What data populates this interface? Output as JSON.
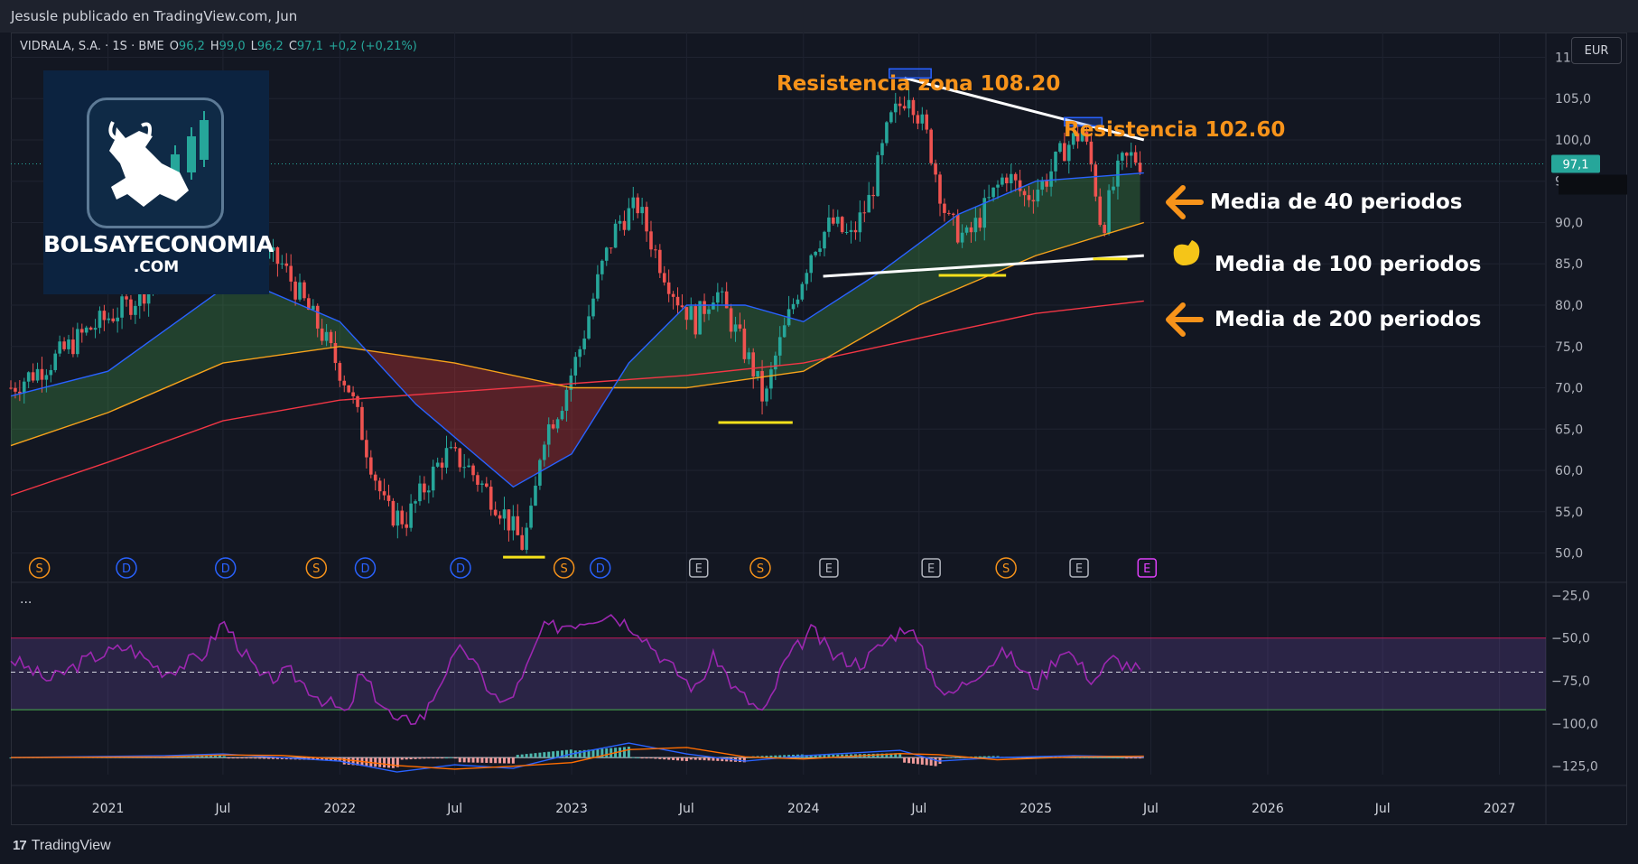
{
  "header": {
    "publisher_text": "Jesusle publicado en TradingView.com, Jun"
  },
  "legend": {
    "symbol": "VIDRALA, S.A. · 1S · BME",
    "open_label": "O",
    "open": "96,2",
    "high_label": "H",
    "high": "99,0",
    "low_label": "L",
    "low": "96,2",
    "close_label": "C",
    "close": "97,1",
    "change": "+0,2 (+0,21%)"
  },
  "currency": "EUR",
  "logo": {
    "name": "BOLSAYECONOMIA",
    "sub": ".COM"
  },
  "pane_menu": "···",
  "annotations": {
    "res1": "Resistencia zona 108.20",
    "res2": "Resistencia 102.60",
    "ma40": "Media de 40 periodos",
    "ma100": "Media de 100 periodos",
    "ma200": "Media de 200 periodos"
  },
  "footer": {
    "brand": "TradingView",
    "mark": "17"
  },
  "colors": {
    "bull": "#26a69a",
    "bear": "#ef5350",
    "ma40": "#2962ff",
    "ma100": "#f7a21b",
    "ma200": "#f23645",
    "rsi": "#9c27b0",
    "accent_orange": "#f7931a",
    "support_yellow": "#f5e11b",
    "trend_white": "#ffffff"
  },
  "chart_data": {
    "type": "candlestick",
    "symbol": "VIDRALA, S.A.",
    "timeframe": "1S",
    "price_axis": {
      "ylim": [
        47,
        113
      ],
      "ticks": [
        "110,0",
        "105,0",
        "100,0",
        "95,0",
        "90,0",
        "85,0",
        "80,0",
        "75,0",
        "70,0",
        "65,0",
        "60,0",
        "55,0",
        "50,0"
      ],
      "last_price": "97,1",
      "last_value": 97.1
    },
    "x_axis": {
      "range": [
        "2020-08-01",
        "2027-03-15"
      ],
      "ticks": [
        {
          "label": "2021",
          "date": "2021-01-01"
        },
        {
          "label": "Jul",
          "date": "2021-07-01"
        },
        {
          "label": "2022",
          "date": "2022-01-01"
        },
        {
          "label": "Jul",
          "date": "2022-07-01"
        },
        {
          "label": "2023",
          "date": "2023-01-01"
        },
        {
          "label": "Jul",
          "date": "2023-07-01"
        },
        {
          "label": "2024",
          "date": "2024-01-01"
        },
        {
          "label": "Jul",
          "date": "2024-07-01"
        },
        {
          "label": "2025",
          "date": "2025-01-01"
        },
        {
          "label": "Jul",
          "date": "2025-07-01"
        },
        {
          "label": "2026",
          "date": "2026-01-01"
        },
        {
          "label": "Jul",
          "date": "2026-07-01"
        },
        {
          "label": "2027",
          "date": "2027-01-01"
        }
      ]
    },
    "price_path": [
      [
        "2020-08-01",
        70
      ],
      [
        "2020-10-01",
        73
      ],
      [
        "2020-12-01",
        77
      ],
      [
        "2021-02-01",
        80
      ],
      [
        "2021-04-01",
        84
      ],
      [
        "2021-06-01",
        88
      ],
      [
        "2021-08-01",
        87
      ],
      [
        "2021-10-01",
        85
      ],
      [
        "2021-12-01",
        77
      ],
      [
        "2022-01-15",
        70
      ],
      [
        "2022-02-15",
        62
      ],
      [
        "2022-03-15",
        55
      ],
      [
        "2022-04-15",
        54
      ],
      [
        "2022-05-15",
        58
      ],
      [
        "2022-06-15",
        62
      ],
      [
        "2022-07-15",
        61
      ],
      [
        "2022-08-15",
        58
      ],
      [
        "2022-09-15",
        55
      ],
      [
        "2022-10-15",
        51
      ],
      [
        "2022-11-01",
        55
      ],
      [
        "2022-11-15",
        64
      ],
      [
        "2022-12-15",
        68
      ],
      [
        "2023-01-15",
        75
      ],
      [
        "2023-02-15",
        84
      ],
      [
        "2023-03-15",
        90
      ],
      [
        "2023-04-15",
        92
      ],
      [
        "2023-05-15",
        86
      ],
      [
        "2023-06-15",
        81
      ],
      [
        "2023-07-15",
        78
      ],
      [
        "2023-08-15",
        82
      ],
      [
        "2023-09-15",
        77
      ],
      [
        "2023-10-15",
        72
      ],
      [
        "2023-11-01",
        68
      ],
      [
        "2023-11-15",
        73
      ],
      [
        "2023-12-15",
        80
      ],
      [
        "2024-01-15",
        87
      ],
      [
        "2024-02-15",
        90
      ],
      [
        "2024-03-15",
        88
      ],
      [
        "2024-04-15",
        93
      ],
      [
        "2024-05-15",
        102
      ],
      [
        "2024-06-15",
        106
      ],
      [
        "2024-07-15",
        100
      ],
      [
        "2024-08-15",
        90
      ],
      [
        "2024-09-15",
        88
      ],
      [
        "2024-10-15",
        92
      ],
      [
        "2024-11-15",
        96
      ],
      [
        "2024-12-15",
        93
      ],
      [
        "2025-01-15",
        95
      ],
      [
        "2025-02-15",
        99
      ],
      [
        "2025-03-15",
        101
      ],
      [
        "2025-04-01",
        96
      ],
      [
        "2025-04-15",
        89
      ],
      [
        "2025-05-01",
        94
      ],
      [
        "2025-05-15",
        97
      ],
      [
        "2025-06-01",
        98
      ],
      [
        "2025-06-20",
        97.1
      ]
    ],
    "ma40": [
      [
        "2020-08-01",
        69
      ],
      [
        "2021-01-01",
        72
      ],
      [
        "2021-07-01",
        82
      ],
      [
        "2021-09-01",
        82
      ],
      [
        "2022-01-01",
        78
      ],
      [
        "2022-05-01",
        68
      ],
      [
        "2022-10-01",
        58
      ],
      [
        "2023-01-01",
        62
      ],
      [
        "2023-04-01",
        73
      ],
      [
        "2023-07-01",
        80
      ],
      [
        "2023-10-01",
        80
      ],
      [
        "2024-01-01",
        78
      ],
      [
        "2024-05-01",
        84
      ],
      [
        "2024-09-01",
        91
      ],
      [
        "2025-01-01",
        95
      ],
      [
        "2025-06-20",
        96
      ]
    ],
    "ma100": [
      [
        "2020-08-01",
        63
      ],
      [
        "2021-01-01",
        67
      ],
      [
        "2021-07-01",
        73
      ],
      [
        "2022-01-01",
        75
      ],
      [
        "2022-07-01",
        73
      ],
      [
        "2023-01-01",
        70
      ],
      [
        "2023-07-01",
        70
      ],
      [
        "2024-01-01",
        72
      ],
      [
        "2024-07-01",
        80
      ],
      [
        "2025-01-01",
        86
      ],
      [
        "2025-06-20",
        90
      ]
    ],
    "ma200": [
      [
        "2020-08-01",
        57
      ],
      [
        "2021-01-01",
        61
      ],
      [
        "2021-07-01",
        66
      ],
      [
        "2022-01-01",
        68.5
      ],
      [
        "2022-07-01",
        69.5
      ],
      [
        "2023-01-01",
        70.5
      ],
      [
        "2023-07-01",
        71.5
      ],
      [
        "2024-01-01",
        73
      ],
      [
        "2024-07-01",
        76
      ],
      [
        "2025-01-01",
        79
      ],
      [
        "2025-06-20",
        80.5
      ]
    ],
    "trendlines": {
      "resistance_descending": [
        [
          "2024-06-08",
          107.5
        ],
        [
          "2025-06-20",
          100
        ]
      ],
      "support_ascending": [
        [
          "2024-02-01",
          83.5
        ],
        [
          "2025-06-20",
          86
        ]
      ],
      "resistance_zone_1": {
        "from": "2024-05-15",
        "to": "2024-07-20",
        "low": 107.5,
        "high": 108.6
      },
      "resistance_zone_2": {
        "from": "2025-02-15",
        "to": "2025-04-15",
        "low": 101.7,
        "high": 102.7
      },
      "support_marks": [
        {
          "from": "2022-09-15",
          "to": "2022-11-20",
          "value": 49.5
        },
        {
          "from": "2023-08-20",
          "to": "2023-12-15",
          "value": 65.8
        },
        {
          "from": "2024-08-01",
          "to": "2024-11-15",
          "value": 83.6
        },
        {
          "from": "2025-04-01",
          "to": "2025-05-25",
          "value": 85.6
        }
      ]
    },
    "events": [
      {
        "date": "2020-09-15",
        "label": "S",
        "kind": "split"
      },
      {
        "date": "2021-01-30",
        "label": "D",
        "kind": "dividend"
      },
      {
        "date": "2021-07-05",
        "label": "D",
        "kind": "dividend"
      },
      {
        "date": "2021-11-25",
        "label": "S",
        "kind": "split"
      },
      {
        "date": "2022-02-10",
        "label": "D",
        "kind": "dividend"
      },
      {
        "date": "2022-07-10",
        "label": "D",
        "kind": "dividend"
      },
      {
        "date": "2022-12-20",
        "label": "S",
        "kind": "split"
      },
      {
        "date": "2023-02-15",
        "label": "D",
        "kind": "dividend"
      },
      {
        "date": "2023-07-20",
        "label": "E",
        "kind": "earnings"
      },
      {
        "date": "2023-10-25",
        "label": "S",
        "kind": "split"
      },
      {
        "date": "2024-02-10",
        "label": "E",
        "kind": "earnings"
      },
      {
        "date": "2024-07-20",
        "label": "E",
        "kind": "earnings"
      },
      {
        "date": "2024-11-15",
        "label": "S",
        "kind": "split"
      },
      {
        "date": "2025-03-10",
        "label": "E",
        "kind": "earnings"
      },
      {
        "date": "2025-06-25",
        "label": "E",
        "kind": "earnings-future"
      }
    ],
    "oscillator_axis": {
      "ylim": [
        -130,
        -20
      ],
      "ticks": [
        "−25,0",
        "−50,0",
        "−75,0",
        "−100,0",
        "−125,0"
      ]
    },
    "rsi_bands": {
      "upper": -50,
      "middle": -70,
      "lower": -92
    },
    "rsi_path": [
      [
        "2020-08-01",
        -62
      ],
      [
        "2020-10-01",
        -75
      ],
      [
        "2020-12-01",
        -62
      ],
      [
        "2021-02-01",
        -55
      ],
      [
        "2021-04-01",
        -70
      ],
      [
        "2021-06-01",
        -60
      ],
      [
        "2021-07-01",
        -40
      ],
      [
        "2021-09-01",
        -75
      ],
      [
        "2021-10-15",
        -70
      ],
      [
        "2021-12-01",
        -85
      ],
      [
        "2022-01-15",
        -95
      ],
      [
        "2022-02-01",
        -70
      ],
      [
        "2022-03-01",
        -85
      ],
      [
        "2022-04-01",
        -100
      ],
      [
        "2022-05-15",
        -95
      ],
      [
        "2022-06-15",
        -70
      ],
      [
        "2022-07-15",
        -55
      ],
      [
        "2022-08-15",
        -75
      ],
      [
        "2022-09-15",
        -90
      ],
      [
        "2022-10-15",
        -75
      ],
      [
        "2022-11-15",
        -45
      ],
      [
        "2023-01-15",
        -40
      ],
      [
        "2023-03-01",
        -35
      ],
      [
        "2023-04-15",
        -45
      ],
      [
        "2023-06-01",
        -65
      ],
      [
        "2023-07-15",
        -80
      ],
      [
        "2023-08-15",
        -60
      ],
      [
        "2023-09-15",
        -80
      ],
      [
        "2023-11-01",
        -95
      ],
      [
        "2023-12-01",
        -65
      ],
      [
        "2024-01-15",
        -45
      ],
      [
        "2024-02-15",
        -60
      ],
      [
        "2024-04-01",
        -65
      ],
      [
        "2024-05-15",
        -50
      ],
      [
        "2024-06-15",
        -42
      ],
      [
        "2024-07-20",
        -70
      ],
      [
        "2024-08-15",
        -85
      ],
      [
        "2024-10-01",
        -70
      ],
      [
        "2024-11-15",
        -58
      ],
      [
        "2025-01-01",
        -78
      ],
      [
        "2025-02-15",
        -55
      ],
      [
        "2025-04-01",
        -75
      ],
      [
        "2025-05-01",
        -62
      ],
      [
        "2025-06-20",
        -70
      ]
    ],
    "macd_axis_value": -120,
    "macd_path": [
      [
        "2020-08-01",
        0
      ],
      [
        "2021-04-01",
        0.5
      ],
      [
        "2021-07-01",
        1
      ],
      [
        "2021-10-01",
        0
      ],
      [
        "2022-01-01",
        -1
      ],
      [
        "2022-04-01",
        -4
      ],
      [
        "2022-07-01",
        -2
      ],
      [
        "2022-10-01",
        -3
      ],
      [
        "2023-01-01",
        1
      ],
      [
        "2023-04-01",
        4
      ],
      [
        "2023-07-01",
        1
      ],
      [
        "2023-10-01",
        -1
      ],
      [
        "2024-01-01",
        0.5
      ],
      [
        "2024-06-01",
        2
      ],
      [
        "2024-08-01",
        -1
      ],
      [
        "2024-11-01",
        0
      ],
      [
        "2025-03-01",
        0.5
      ],
      [
        "2025-06-20",
        0.2
      ]
    ]
  }
}
